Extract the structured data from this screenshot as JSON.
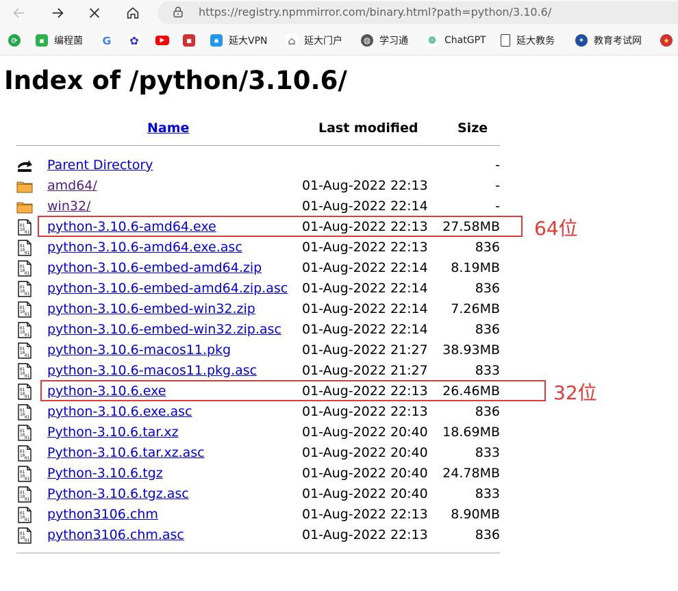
{
  "browser": {
    "url": "https://registry.npmmirror.com/binary.html?path=python/3.10.6/",
    "bookmarks": [
      {
        "label": "",
        "icon": "refresh-green-icon"
      },
      {
        "label": "编程菌",
        "icon": "chat-green-icon"
      },
      {
        "label": "",
        "icon": "google-icon"
      },
      {
        "label": "",
        "icon": "baidu-paw-icon"
      },
      {
        "label": "",
        "icon": "youtube-icon"
      },
      {
        "label": "",
        "icon": "red-badge-icon"
      },
      {
        "label": "延大VPN",
        "icon": "lock-blue-icon"
      },
      {
        "label": "延大门户",
        "icon": "home-outline-icon"
      },
      {
        "label": "学习通",
        "icon": "globe-icon"
      },
      {
        "label": "ChatGPT",
        "icon": "openai-icon"
      },
      {
        "label": "延大教务",
        "icon": "document-icon"
      },
      {
        "label": "教育考试网",
        "icon": "emblem-blue-icon"
      },
      {
        "label": "",
        "icon": "emblem-red-icon"
      }
    ]
  },
  "page": {
    "title": "Index of /python/3.10.6/",
    "columns": {
      "name": "Name",
      "modified": "Last modified",
      "size": "Size"
    },
    "rows": [
      {
        "name": "Parent Directory",
        "modified": "",
        "size": "-",
        "icon": "back-arrow-icon",
        "visited": false
      },
      {
        "name": "amd64/",
        "modified": "01-Aug-2022 22:13",
        "size": "-",
        "icon": "folder-icon",
        "visited": true
      },
      {
        "name": "win32/",
        "modified": "01-Aug-2022 22:14",
        "size": "-",
        "icon": "folder-icon",
        "visited": true
      },
      {
        "name": "python-3.10.6-amd64.exe",
        "modified": "01-Aug-2022 22:13",
        "size": "27.58MB",
        "icon": "binary-file-icon",
        "visited": false
      },
      {
        "name": "python-3.10.6-amd64.exe.asc",
        "modified": "01-Aug-2022 22:13",
        "size": "836",
        "icon": "binary-file-icon",
        "visited": false
      },
      {
        "name": "python-3.10.6-embed-amd64.zip",
        "modified": "01-Aug-2022 22:14",
        "size": "8.19MB",
        "icon": "binary-file-icon",
        "visited": false
      },
      {
        "name": "python-3.10.6-embed-amd64.zip.asc",
        "modified": "01-Aug-2022 22:14",
        "size": "836",
        "icon": "binary-file-icon",
        "visited": false
      },
      {
        "name": "python-3.10.6-embed-win32.zip",
        "modified": "01-Aug-2022 22:14",
        "size": "7.26MB",
        "icon": "binary-file-icon",
        "visited": false
      },
      {
        "name": "python-3.10.6-embed-win32.zip.asc",
        "modified": "01-Aug-2022 22:14",
        "size": "836",
        "icon": "binary-file-icon",
        "visited": false
      },
      {
        "name": "python-3.10.6-macos11.pkg",
        "modified": "01-Aug-2022 21:27",
        "size": "38.93MB",
        "icon": "binary-file-icon",
        "visited": false
      },
      {
        "name": "python-3.10.6-macos11.pkg.asc",
        "modified": "01-Aug-2022 21:27",
        "size": "833",
        "icon": "binary-file-icon",
        "visited": false
      },
      {
        "name": "python-3.10.6.exe",
        "modified": "01-Aug-2022 22:13",
        "size": "26.46MB",
        "icon": "binary-file-icon",
        "visited": false
      },
      {
        "name": "python-3.10.6.exe.asc",
        "modified": "01-Aug-2022 22:13",
        "size": "836",
        "icon": "binary-file-icon",
        "visited": false
      },
      {
        "name": "Python-3.10.6.tar.xz",
        "modified": "01-Aug-2022 20:40",
        "size": "18.69MB",
        "icon": "binary-file-icon",
        "visited": false
      },
      {
        "name": "Python-3.10.6.tar.xz.asc",
        "modified": "01-Aug-2022 20:40",
        "size": "833",
        "icon": "binary-file-icon",
        "visited": false
      },
      {
        "name": "Python-3.10.6.tgz",
        "modified": "01-Aug-2022 20:40",
        "size": "24.78MB",
        "icon": "binary-file-icon",
        "visited": false
      },
      {
        "name": "Python-3.10.6.tgz.asc",
        "modified": "01-Aug-2022 20:40",
        "size": "833",
        "icon": "binary-file-icon",
        "visited": false
      },
      {
        "name": "python3106.chm",
        "modified": "01-Aug-2022 22:13",
        "size": "8.90MB",
        "icon": "binary-file-icon",
        "visited": false
      },
      {
        "name": "python3106.chm.asc",
        "modified": "01-Aug-2022 22:13",
        "size": "836",
        "icon": "binary-file-icon",
        "visited": false
      }
    ]
  },
  "annotations": [
    {
      "label": "64位",
      "row": "python-3.10.6-amd64.exe",
      "color": "#e53935"
    },
    {
      "label": "32位",
      "row": "python-3.10.6.exe",
      "color": "#e53935"
    }
  ]
}
